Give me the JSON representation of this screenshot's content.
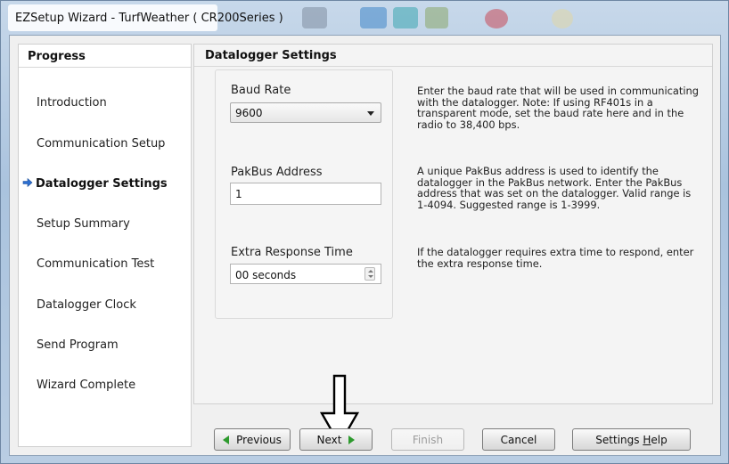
{
  "window": {
    "title": "EZSetup Wizard - TurfWeather ( CR200Series )"
  },
  "progress": {
    "heading": "Progress",
    "steps": [
      {
        "label": "Introduction"
      },
      {
        "label": "Communication Setup"
      },
      {
        "label": "Datalogger Settings",
        "current": true
      },
      {
        "label": "Setup Summary"
      },
      {
        "label": "Communication Test"
      },
      {
        "label": "Datalogger Clock"
      },
      {
        "label": "Send Program"
      },
      {
        "label": "Wizard Complete"
      }
    ]
  },
  "settings": {
    "heading": "Datalogger Settings",
    "baud_rate": {
      "label": "Baud Rate",
      "value": "9600",
      "description": "Enter the baud rate that will be used in communicating with the datalogger. Note: If using RF401s in a transparent mode, set the baud rate here and in the radio to 38,400 bps."
    },
    "pakbus_address": {
      "label": "PakBus Address",
      "value": "1",
      "description": "A unique PakBus address is used to identify the datalogger in the PakBus network.  Enter the PakBus address that was set on the datalogger. Valid range is 1-4094.  Suggested range is 1-3999."
    },
    "extra_response_time": {
      "label": "Extra Response Time",
      "value": "00 seconds",
      "description": "If the datalogger requires extra time to respond, enter the extra response time."
    }
  },
  "buttons": {
    "previous": "Previous",
    "next": "Next",
    "finish": "Finish",
    "cancel": "Cancel",
    "settings_help_prefix": "Settings ",
    "settings_help_underlined": "H",
    "settings_help_suffix": "elp"
  },
  "colors": {
    "accent_arrow": "#2d9a2d",
    "current_step_arrow": "#2c6fd1"
  }
}
